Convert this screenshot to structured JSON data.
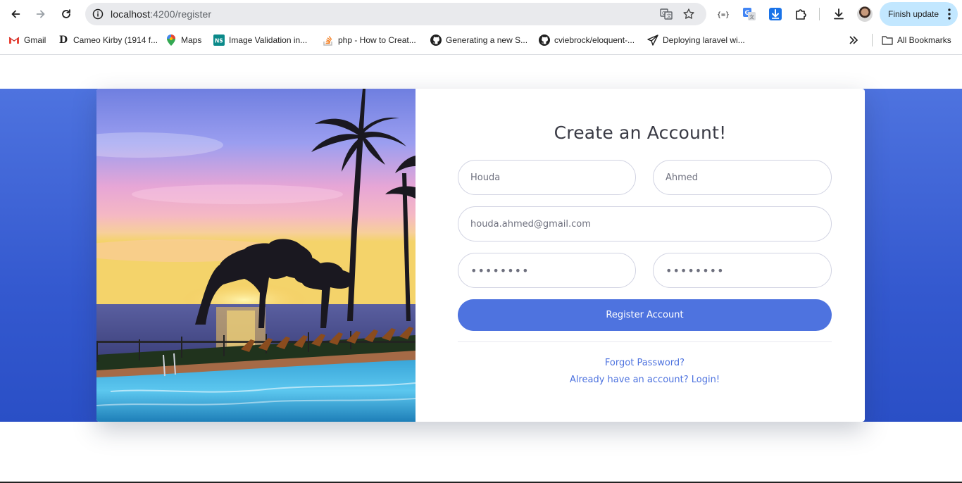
{
  "browser": {
    "url_host": "localhost",
    "url_path": ":4200/register",
    "finish_update_label": "Finish update",
    "bookmarks": [
      {
        "label": "Gmail",
        "icon": "gmail-icon"
      },
      {
        "label": "Cameo Kirby (1914 f...",
        "icon": "letter-d-icon"
      },
      {
        "label": "Maps",
        "icon": "maps-pin-icon"
      },
      {
        "label": "Image Validation in...",
        "icon": "ns-icon"
      },
      {
        "label": "php - How to Creat...",
        "icon": "stackoverflow-icon"
      },
      {
        "label": "Generating a new S...",
        "icon": "github-icon"
      },
      {
        "label": "cviebrock/eloquent-...",
        "icon": "github-icon"
      },
      {
        "label": "Deploying laravel wi...",
        "icon": "paper-plane-icon"
      }
    ],
    "all_bookmarks_label": "All Bookmarks",
    "colors": {
      "accent": "#c2e7ff",
      "omnibox": "#e9eaed"
    }
  },
  "form": {
    "title": "Create an Account!",
    "first_name": "Houda",
    "last_name": "Ahmed",
    "email": "houda.ahmed@gmail.com",
    "password_mask": "••••••••",
    "repeat_password_mask": "••••••••",
    "register_label": "Register Account",
    "forgot_password_label": "Forgot Password?",
    "login_label": "Already have an account? Login!",
    "colors": {
      "primary": "#4e73df",
      "background_band": "#3459cf"
    }
  }
}
